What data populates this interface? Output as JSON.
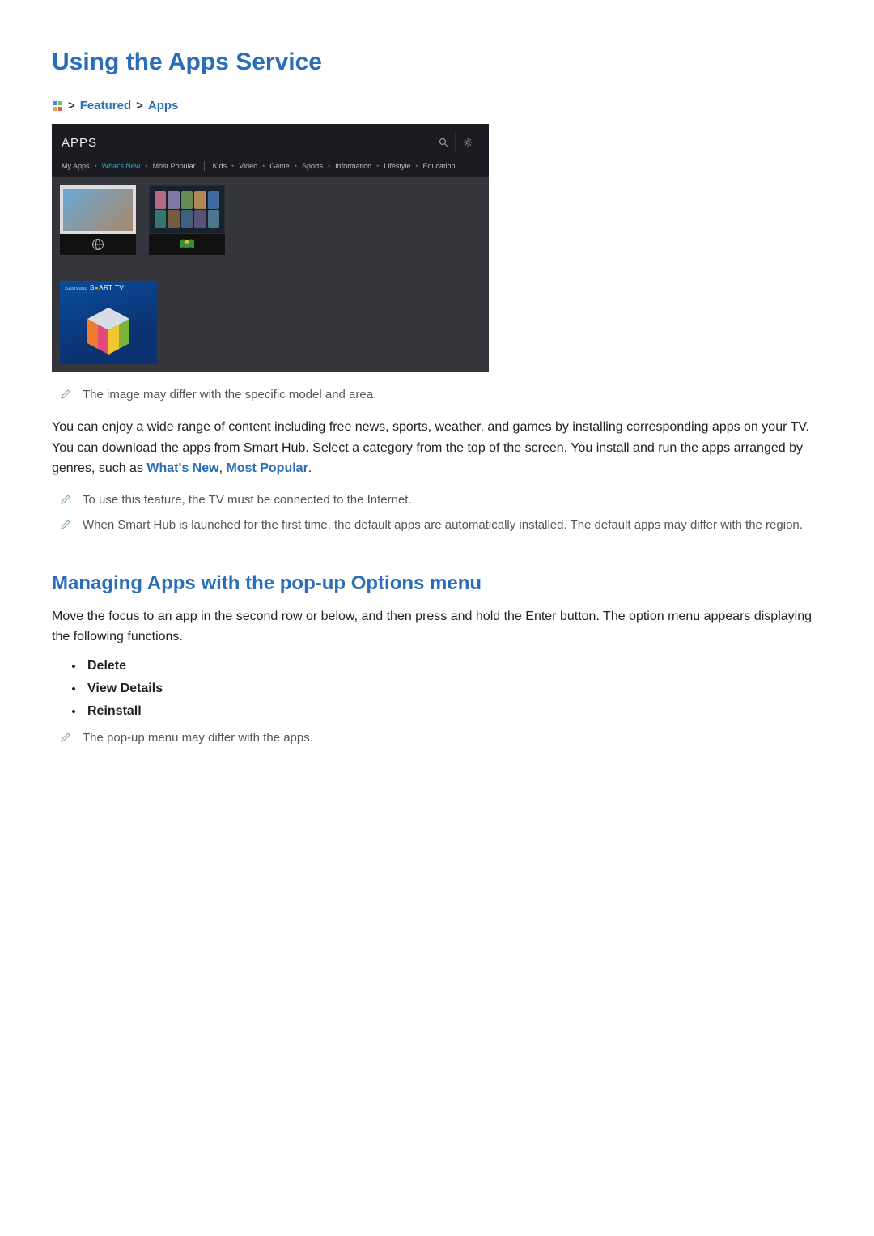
{
  "title": "Using the Apps Service",
  "breadcrumb": {
    "featured": "Featured",
    "apps": "Apps"
  },
  "apps_panel": {
    "title": "APPS",
    "tabs": [
      "My Apps",
      "What's New",
      "Most Popular"
    ],
    "cats": [
      "Kids",
      "Video",
      "Game",
      "Sports",
      "Information",
      "Lifestyle",
      "Education"
    ],
    "smart_tv": "SMART TV"
  },
  "notes": {
    "img_differ": "The image may differ with the specific model and area.",
    "internet": "To use this feature, the TV must be connected to the Internet.",
    "default_apps": "When Smart Hub is launched for the first time, the default apps are automatically installed. The default apps may differ with the region.",
    "popup_differ": "The pop-up menu may differ with the apps."
  },
  "paragraphs": {
    "p1a": "You can enjoy a wide range of content including free news, sports, weather, and games by installing corresponding apps on your TV. You can download the apps from Smart Hub. Select a category from the top of the screen. You install and run the apps arranged by genres, such as ",
    "link1": "What's New",
    "sep": ", ",
    "link2": "Most Popular",
    "p1b": ".",
    "p2": "Move the focus to an app in the second row or below, and then press and hold the Enter button. The option menu appears displaying the following functions."
  },
  "h2": "Managing Apps with the pop-up Options menu",
  "options": [
    "Delete",
    "View Details",
    "Reinstall"
  ]
}
